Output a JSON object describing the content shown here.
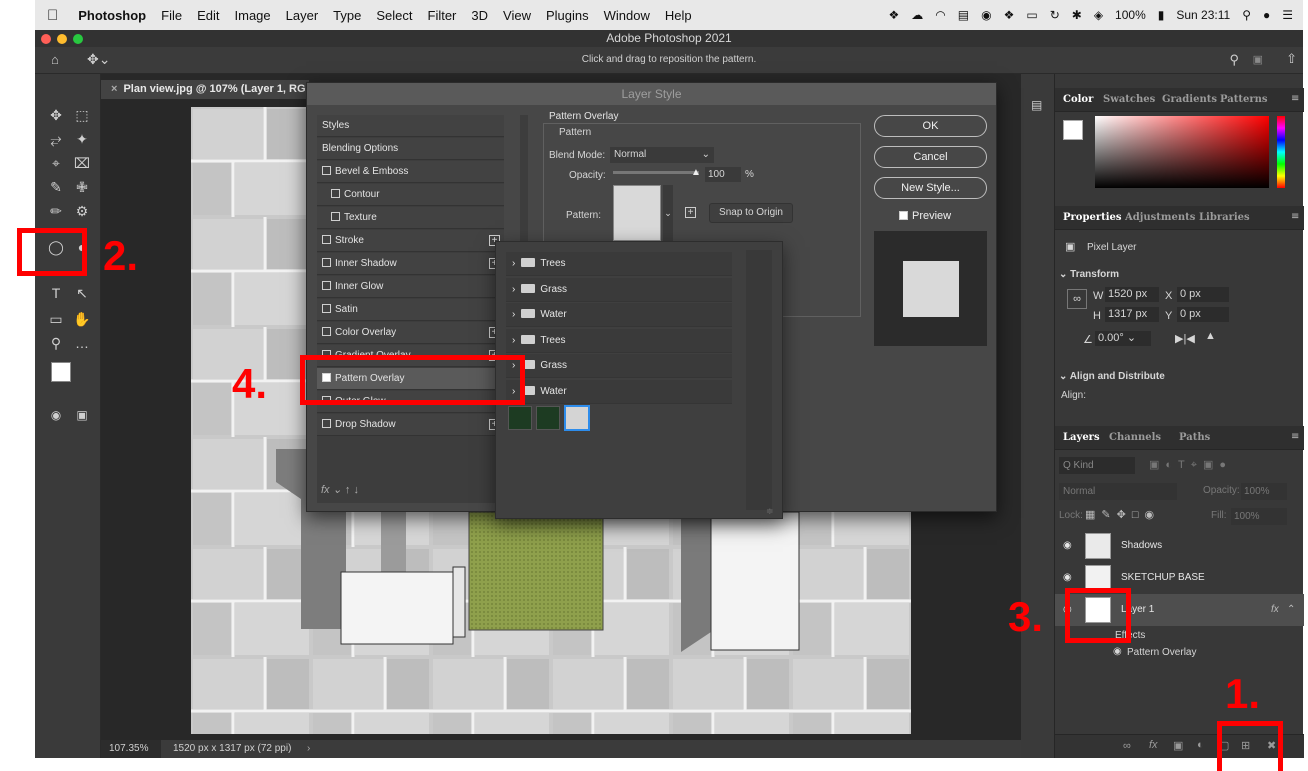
{
  "menubar": {
    "app": "Photoshop",
    "items": [
      "File",
      "Edit",
      "Image",
      "Layer",
      "Type",
      "Select",
      "Filter",
      "3D",
      "View",
      "Plugins",
      "Window",
      "Help"
    ],
    "battery": "100%",
    "clock": "Sun 23:11"
  },
  "window": {
    "title": "Adobe Photoshop 2021"
  },
  "optionsbar": {
    "message": "Click and drag to reposition the pattern."
  },
  "document": {
    "tab": "Plan view.jpg @ 107% (Layer 1, RGB/",
    "zoom": "107.35%",
    "dimensions": "1520 px x 1317 px (72 ppi)"
  },
  "dialog": {
    "title": "Layer Style",
    "styles": [
      {
        "label": "Styles",
        "check": false,
        "plus": false,
        "header": true
      },
      {
        "label": "Blending Options",
        "check": false,
        "plus": false,
        "header": true
      },
      {
        "label": "Bevel & Emboss",
        "check": true,
        "checked": false,
        "plus": false
      },
      {
        "label": "Contour",
        "check": true,
        "checked": false,
        "plus": false,
        "indent": true
      },
      {
        "label": "Texture",
        "check": true,
        "checked": false,
        "plus": false,
        "indent": true
      },
      {
        "label": "Stroke",
        "check": true,
        "checked": false,
        "plus": true
      },
      {
        "label": "Inner Shadow",
        "check": true,
        "checked": false,
        "plus": true
      },
      {
        "label": "Inner Glow",
        "check": true,
        "checked": false,
        "plus": false
      },
      {
        "label": "Satin",
        "check": true,
        "checked": false,
        "plus": false
      },
      {
        "label": "Color Overlay",
        "check": true,
        "checked": false,
        "plus": true
      },
      {
        "label": "Gradient Overlay",
        "check": true,
        "checked": false,
        "plus": true
      },
      {
        "label": "Pattern Overlay",
        "check": true,
        "checked": true,
        "plus": false,
        "active": true
      },
      {
        "label": "Outer Glow",
        "check": true,
        "checked": false,
        "plus": false
      },
      {
        "label": "Drop Shadow",
        "check": true,
        "checked": false,
        "plus": true
      }
    ],
    "section": "Pattern Overlay",
    "group": "Pattern",
    "blend_mode_label": "Blend Mode:",
    "blend_mode_value": "Normal",
    "opacity_label": "Opacity:",
    "opacity_value": "100",
    "opacity_unit": "%",
    "pattern_label": "Pattern:",
    "snap_button": "Snap to Origin",
    "ok_button": "OK",
    "cancel_button": "Cancel",
    "new_style_button": "New Style...",
    "preview_label": "Preview"
  },
  "picker": {
    "folders": [
      "Trees",
      "Grass",
      "Water",
      "Trees",
      "Grass",
      "Water"
    ]
  },
  "panels": {
    "color_tabs": [
      "Color",
      "Swatches",
      "Gradients",
      "Patterns"
    ],
    "props_tabs": [
      "Properties",
      "Adjustments",
      "Libraries"
    ],
    "pixel_layer": "Pixel Layer",
    "transform_label": "Transform",
    "w_label": "W",
    "w_value": "1520 px",
    "h_label": "H",
    "h_value": "1317 px",
    "x_label": "X",
    "x_value": "0 px",
    "y_label": "Y",
    "y_value": "0 px",
    "angle_value": "0.00°",
    "align_label": "Align and Distribute",
    "align_sub": "Align:",
    "layer_tabs": [
      "Layers",
      "Channels",
      "Paths"
    ],
    "kind_label": "Q Kind",
    "blend": "Normal",
    "opacity_label": "Opacity:",
    "opacity_value": "100%",
    "lock_label": "Lock:",
    "fill_label": "Fill:",
    "fill_value": "100%",
    "layers": [
      "Shadows",
      "SKETCHUP BASE",
      "Layer 1"
    ],
    "effects_label": "Effects",
    "effect_item": "Pattern Overlay",
    "fx_label": "fx"
  },
  "annotations": [
    "1.",
    "2.",
    "3.",
    "4."
  ]
}
